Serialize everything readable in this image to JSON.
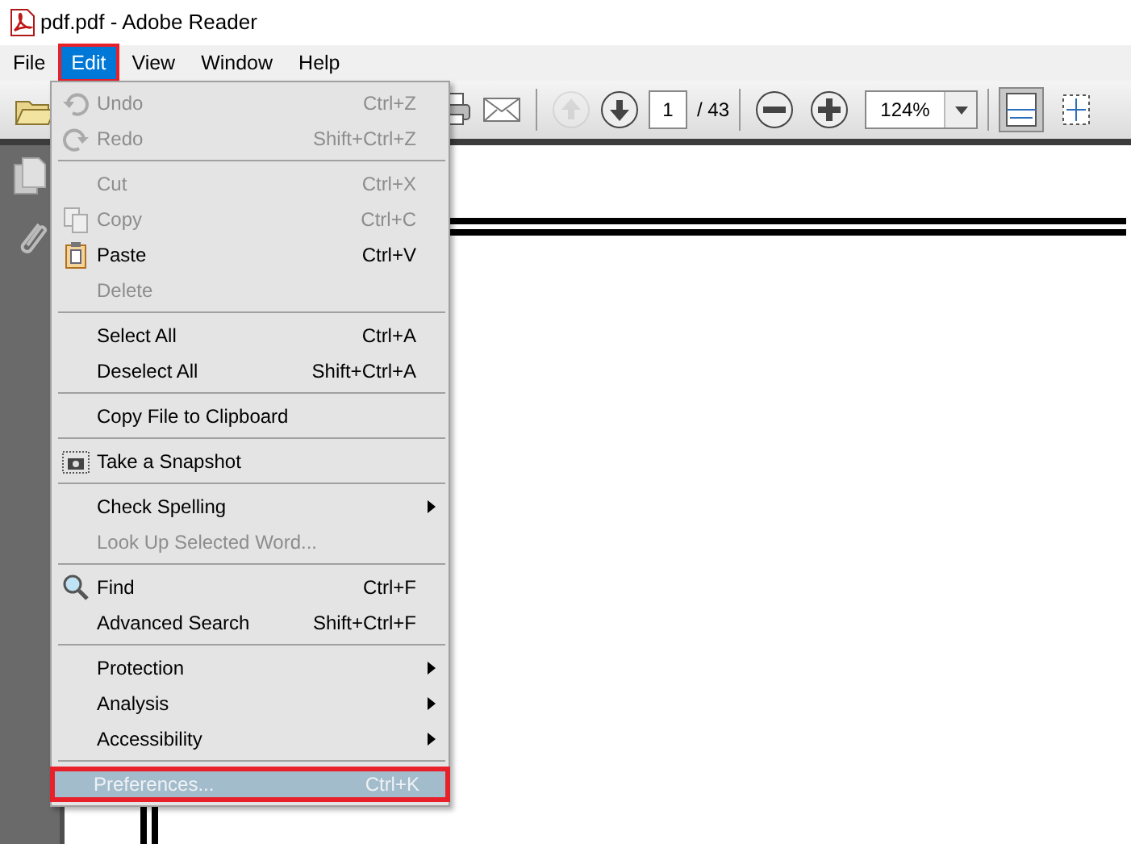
{
  "window": {
    "title": "pdf.pdf - Adobe Reader"
  },
  "menubar": [
    {
      "label": "File",
      "selected": false,
      "annotated": false
    },
    {
      "label": "Edit",
      "selected": true,
      "annotated": true
    },
    {
      "label": "View",
      "selected": false,
      "annotated": false
    },
    {
      "label": "Window",
      "selected": false,
      "annotated": false
    },
    {
      "label": "Help",
      "selected": false,
      "annotated": false
    }
  ],
  "toolbar": {
    "buttons": [
      {
        "kind": "open"
      },
      {
        "kind": "print"
      },
      {
        "kind": "email"
      },
      {
        "kind": "previous",
        "disabled": true
      },
      {
        "kind": "next",
        "disabled": false
      }
    ],
    "page": "1",
    "page_count": "/ 43",
    "zoom_buttons": [
      {
        "kind": "zoom-out",
        "disabled": false
      },
      {
        "kind": "zoom-in",
        "disabled": false
      }
    ],
    "zoom": "124%",
    "view_buttons": [
      {
        "kind": "fit-page",
        "selected": true
      },
      {
        "kind": "fit-width",
        "selected": false
      }
    ]
  },
  "edit_menu": [
    {
      "kind": "item",
      "label": "Undo",
      "shortcut": "Ctrl+Z",
      "disabled": true,
      "submenu": false,
      "highlighted": false,
      "annotated": false
    },
    {
      "kind": "item",
      "label": "Redo",
      "shortcut": "Shift+Ctrl+Z",
      "disabled": true,
      "submenu": false,
      "highlighted": false,
      "annotated": false
    },
    {
      "kind": "separator"
    },
    {
      "kind": "item",
      "label": "Cut",
      "shortcut": "Ctrl+X",
      "disabled": true,
      "submenu": false,
      "highlighted": false,
      "annotated": false
    },
    {
      "kind": "item",
      "label": "Copy",
      "shortcut": "Ctrl+C",
      "disabled": true,
      "submenu": false,
      "highlighted": false,
      "annotated": false
    },
    {
      "kind": "item",
      "label": "Paste",
      "shortcut": "Ctrl+V",
      "disabled": false,
      "submenu": false,
      "highlighted": false,
      "annotated": false
    },
    {
      "kind": "item",
      "label": "Delete",
      "disabled": true,
      "submenu": false,
      "highlighted": false,
      "annotated": false
    },
    {
      "kind": "separator"
    },
    {
      "kind": "item",
      "label": "Select All",
      "shortcut": "Ctrl+A",
      "disabled": false,
      "submenu": false,
      "highlighted": false,
      "annotated": false
    },
    {
      "kind": "item",
      "label": "Deselect All",
      "shortcut": "Shift+Ctrl+A",
      "disabled": false,
      "submenu": false,
      "highlighted": false,
      "annotated": false
    },
    {
      "kind": "separator"
    },
    {
      "kind": "item",
      "label": "Copy File to Clipboard",
      "disabled": false,
      "submenu": false,
      "highlighted": false,
      "annotated": false
    },
    {
      "kind": "separator"
    },
    {
      "kind": "item",
      "label": "Take a Snapshot",
      "disabled": false,
      "submenu": false,
      "highlighted": false,
      "annotated": false
    },
    {
      "kind": "separator"
    },
    {
      "kind": "item",
      "label": "Check Spelling",
      "disabled": false,
      "submenu": true,
      "highlighted": false,
      "annotated": false
    },
    {
      "kind": "item",
      "label": "Look Up Selected Word...",
      "disabled": true,
      "submenu": false,
      "highlighted": false,
      "annotated": false
    },
    {
      "kind": "separator"
    },
    {
      "kind": "item",
      "label": "Find",
      "shortcut": "Ctrl+F",
      "disabled": false,
      "submenu": false,
      "highlighted": false,
      "annotated": false
    },
    {
      "kind": "item",
      "label": "Advanced Search",
      "shortcut": "Shift+Ctrl+F",
      "disabled": false,
      "submenu": false,
      "highlighted": false,
      "annotated": false
    },
    {
      "kind": "separator"
    },
    {
      "kind": "item",
      "label": "Protection",
      "disabled": false,
      "submenu": true,
      "highlighted": false,
      "annotated": false
    },
    {
      "kind": "item",
      "label": "Analysis",
      "disabled": false,
      "submenu": true,
      "highlighted": false,
      "annotated": false
    },
    {
      "kind": "item",
      "label": "Accessibility",
      "disabled": false,
      "submenu": true,
      "highlighted": false,
      "annotated": false
    },
    {
      "kind": "separator"
    },
    {
      "kind": "item",
      "label": "Preferences...",
      "shortcut": "Ctrl+K",
      "disabled": true,
      "submenu": false,
      "highlighted": true,
      "annotated": true
    }
  ]
}
